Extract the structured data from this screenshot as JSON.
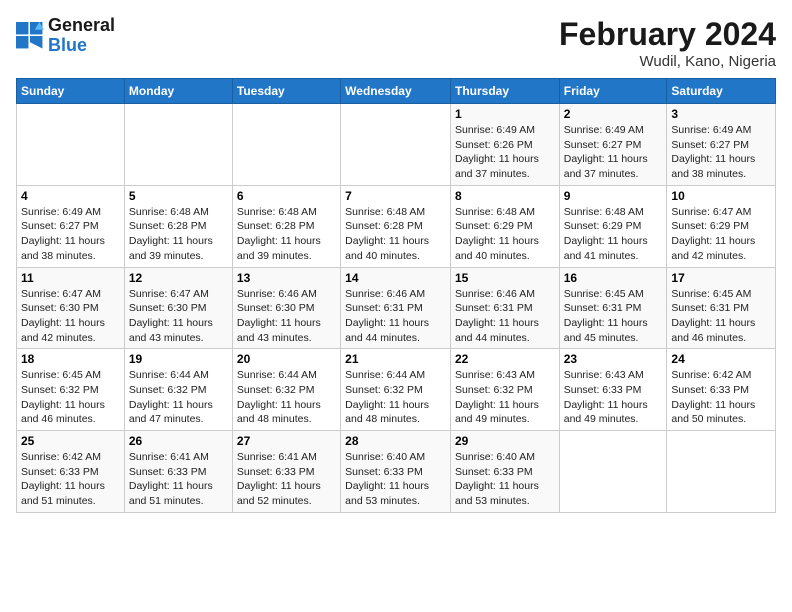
{
  "header": {
    "logo_general": "General",
    "logo_blue": "Blue",
    "month_year": "February 2024",
    "location": "Wudil, Kano, Nigeria"
  },
  "days_of_week": [
    "Sunday",
    "Monday",
    "Tuesday",
    "Wednesday",
    "Thursday",
    "Friday",
    "Saturday"
  ],
  "weeks": [
    [
      {
        "day": "",
        "content": ""
      },
      {
        "day": "",
        "content": ""
      },
      {
        "day": "",
        "content": ""
      },
      {
        "day": "",
        "content": ""
      },
      {
        "day": "1",
        "content": "Sunrise: 6:49 AM\nSunset: 6:26 PM\nDaylight: 11 hours and 37 minutes."
      },
      {
        "day": "2",
        "content": "Sunrise: 6:49 AM\nSunset: 6:27 PM\nDaylight: 11 hours and 37 minutes."
      },
      {
        "day": "3",
        "content": "Sunrise: 6:49 AM\nSunset: 6:27 PM\nDaylight: 11 hours and 38 minutes."
      }
    ],
    [
      {
        "day": "4",
        "content": "Sunrise: 6:49 AM\nSunset: 6:27 PM\nDaylight: 11 hours and 38 minutes."
      },
      {
        "day": "5",
        "content": "Sunrise: 6:48 AM\nSunset: 6:28 PM\nDaylight: 11 hours and 39 minutes."
      },
      {
        "day": "6",
        "content": "Sunrise: 6:48 AM\nSunset: 6:28 PM\nDaylight: 11 hours and 39 minutes."
      },
      {
        "day": "7",
        "content": "Sunrise: 6:48 AM\nSunset: 6:28 PM\nDaylight: 11 hours and 40 minutes."
      },
      {
        "day": "8",
        "content": "Sunrise: 6:48 AM\nSunset: 6:29 PM\nDaylight: 11 hours and 40 minutes."
      },
      {
        "day": "9",
        "content": "Sunrise: 6:48 AM\nSunset: 6:29 PM\nDaylight: 11 hours and 41 minutes."
      },
      {
        "day": "10",
        "content": "Sunrise: 6:47 AM\nSunset: 6:29 PM\nDaylight: 11 hours and 42 minutes."
      }
    ],
    [
      {
        "day": "11",
        "content": "Sunrise: 6:47 AM\nSunset: 6:30 PM\nDaylight: 11 hours and 42 minutes."
      },
      {
        "day": "12",
        "content": "Sunrise: 6:47 AM\nSunset: 6:30 PM\nDaylight: 11 hours and 43 minutes."
      },
      {
        "day": "13",
        "content": "Sunrise: 6:46 AM\nSunset: 6:30 PM\nDaylight: 11 hours and 43 minutes."
      },
      {
        "day": "14",
        "content": "Sunrise: 6:46 AM\nSunset: 6:31 PM\nDaylight: 11 hours and 44 minutes."
      },
      {
        "day": "15",
        "content": "Sunrise: 6:46 AM\nSunset: 6:31 PM\nDaylight: 11 hours and 44 minutes."
      },
      {
        "day": "16",
        "content": "Sunrise: 6:45 AM\nSunset: 6:31 PM\nDaylight: 11 hours and 45 minutes."
      },
      {
        "day": "17",
        "content": "Sunrise: 6:45 AM\nSunset: 6:31 PM\nDaylight: 11 hours and 46 minutes."
      }
    ],
    [
      {
        "day": "18",
        "content": "Sunrise: 6:45 AM\nSunset: 6:32 PM\nDaylight: 11 hours and 46 minutes."
      },
      {
        "day": "19",
        "content": "Sunrise: 6:44 AM\nSunset: 6:32 PM\nDaylight: 11 hours and 47 minutes."
      },
      {
        "day": "20",
        "content": "Sunrise: 6:44 AM\nSunset: 6:32 PM\nDaylight: 11 hours and 48 minutes."
      },
      {
        "day": "21",
        "content": "Sunrise: 6:44 AM\nSunset: 6:32 PM\nDaylight: 11 hours and 48 minutes."
      },
      {
        "day": "22",
        "content": "Sunrise: 6:43 AM\nSunset: 6:32 PM\nDaylight: 11 hours and 49 minutes."
      },
      {
        "day": "23",
        "content": "Sunrise: 6:43 AM\nSunset: 6:33 PM\nDaylight: 11 hours and 49 minutes."
      },
      {
        "day": "24",
        "content": "Sunrise: 6:42 AM\nSunset: 6:33 PM\nDaylight: 11 hours and 50 minutes."
      }
    ],
    [
      {
        "day": "25",
        "content": "Sunrise: 6:42 AM\nSunset: 6:33 PM\nDaylight: 11 hours and 51 minutes."
      },
      {
        "day": "26",
        "content": "Sunrise: 6:41 AM\nSunset: 6:33 PM\nDaylight: 11 hours and 51 minutes."
      },
      {
        "day": "27",
        "content": "Sunrise: 6:41 AM\nSunset: 6:33 PM\nDaylight: 11 hours and 52 minutes."
      },
      {
        "day": "28",
        "content": "Sunrise: 6:40 AM\nSunset: 6:33 PM\nDaylight: 11 hours and 53 minutes."
      },
      {
        "day": "29",
        "content": "Sunrise: 6:40 AM\nSunset: 6:33 PM\nDaylight: 11 hours and 53 minutes."
      },
      {
        "day": "",
        "content": ""
      },
      {
        "day": "",
        "content": ""
      }
    ]
  ]
}
